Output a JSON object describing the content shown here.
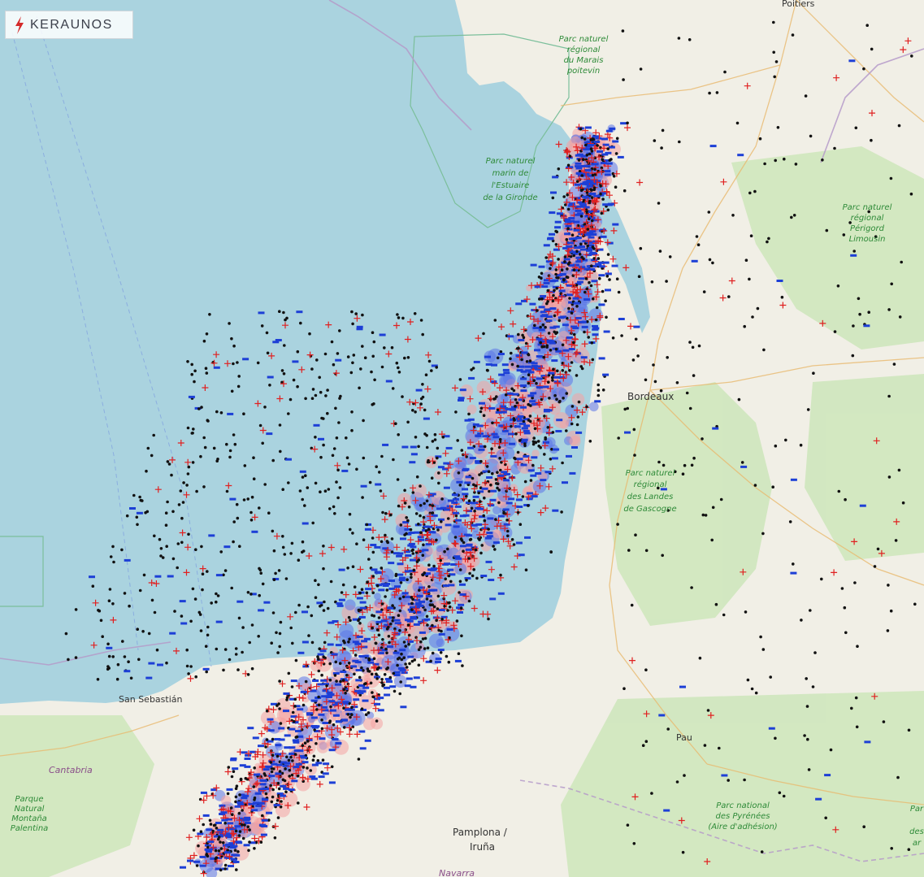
{
  "brand": {
    "name": "KERAUNOS",
    "accent": "#d42a2a"
  },
  "colors": {
    "sea": "#aad3df",
    "land": "#f2efe9",
    "forest": "#cde6b8",
    "positive_strike": "#e02020",
    "negative_strike": "#1d3fd6",
    "intracloud": "#111111",
    "density_red": "#f4a3a3",
    "density_blue": "#5b75e8"
  },
  "map": {
    "cities": [
      {
        "key": "poitiers",
        "label": "Poitiers"
      },
      {
        "key": "bordeaux",
        "label": "Bordeaux"
      },
      {
        "key": "pau",
        "label": "Pau"
      },
      {
        "key": "pamplona",
        "label": "Pamplona /"
      },
      {
        "key": "iruna",
        "label": "Iruña"
      },
      {
        "key": "san_sebastian",
        "label": "San Sebastián"
      },
      {
        "key": "cantabria",
        "label": "Cantabria"
      },
      {
        "key": "navarra",
        "label": "Navarra"
      }
    ],
    "parks": [
      {
        "key": "marais",
        "lines": [
          "Parc naturel",
          "régional",
          "du Marais",
          "poitevin"
        ]
      },
      {
        "key": "estuaire",
        "lines": [
          "Parc naturel",
          "marin de",
          "l'Estuaire",
          "de la Gironde"
        ]
      },
      {
        "key": "perigord",
        "lines": [
          "Parc naturel",
          "régional",
          "Périgord",
          "Limousin"
        ]
      },
      {
        "key": "landes",
        "lines": [
          "Parc naturel",
          "régional",
          "des Landes",
          "de Gascogne"
        ]
      },
      {
        "key": "pyrenees",
        "lines": [
          "Parc national",
          "des Pyrénées",
          "(Aire d'adhésion)"
        ]
      },
      {
        "key": "palentina",
        "lines": [
          "Parque",
          "Natural",
          "Montaña",
          "Palentina"
        ]
      },
      {
        "key": "right_edge",
        "lines": [
          "Par",
          "des",
          "ar"
        ]
      }
    ]
  },
  "legend": {
    "positive_symbol": "plus-sign",
    "negative_symbol": "minus-sign",
    "intracloud_symbol": "dot"
  }
}
